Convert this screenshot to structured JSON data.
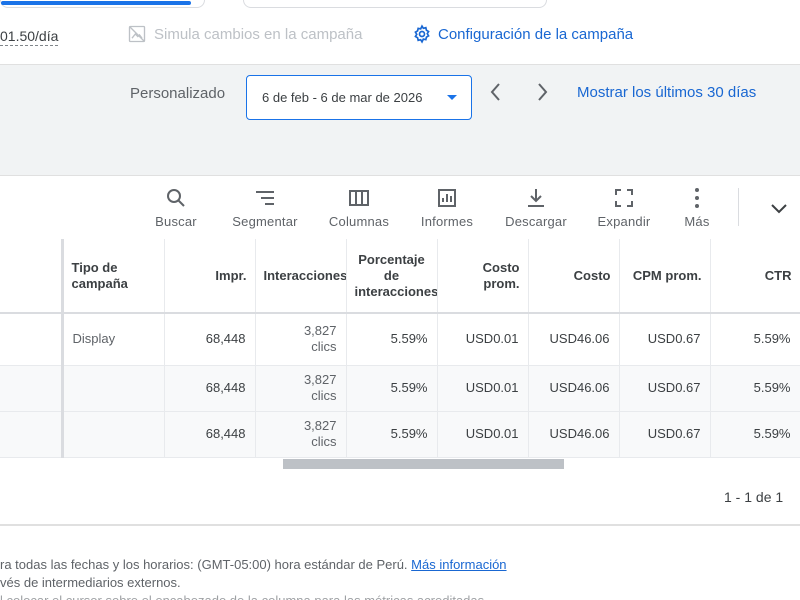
{
  "header": {
    "budget": "01.50/día",
    "simulate_label": "Simula cambios en la campaña",
    "config_label": "Configuración de la campaña"
  },
  "date_bar": {
    "preset_label": "Personalizado",
    "date_range": "6 de feb - 6 de mar de 2026",
    "show_last_label": "Mostrar los últimos 30 días"
  },
  "toolbar": {
    "items": [
      {
        "label": "Buscar",
        "icon": "search-icon"
      },
      {
        "label": "Segmentar",
        "icon": "segment-icon"
      },
      {
        "label": "Columnas",
        "icon": "columns-icon"
      },
      {
        "label": "Informes",
        "icon": "reports-icon"
      },
      {
        "label": "Descargar",
        "icon": "download-icon"
      },
      {
        "label": "Expandir",
        "icon": "expand-icon"
      },
      {
        "label": "Más",
        "icon": "more-vert-icon"
      }
    ]
  },
  "table": {
    "headers": [
      "Tipo de campaña",
      "Impr.",
      "Interacciones",
      "Porcentaje de interacciones",
      "Costo prom.",
      "Costo",
      "CPM prom.",
      "CTR"
    ],
    "rows": [
      {
        "type": "Display",
        "impr": "68,448",
        "inter_num": "3,827",
        "inter_unit": "clics",
        "rate": "5.59%",
        "avg_cost": "USD0.01",
        "cost": "USD46.06",
        "cpm": "USD0.67",
        "ctr": "5.59%"
      },
      {
        "type": "",
        "impr": "68,448",
        "inter_num": "3,827",
        "inter_unit": "clics",
        "rate": "5.59%",
        "avg_cost": "USD0.01",
        "cost": "USD46.06",
        "cpm": "USD0.67",
        "ctr": "5.59%"
      },
      {
        "type": "",
        "impr": "68,448",
        "inter_num": "3,827",
        "inter_unit": "clics",
        "rate": "5.59%",
        "avg_cost": "USD0.01",
        "cost": "USD46.06",
        "cpm": "USD0.67",
        "ctr": "5.59%"
      }
    ]
  },
  "pager": {
    "text": "1 - 1 de 1"
  },
  "footer": {
    "line1": "ra todas las fechas y los horarios: (GMT-05:00) hora estándar de Perú.",
    "line1_link": "Más información",
    "line2": "vés de intermediarios externos.",
    "line3": "l colocar el cursor sobre el encabezado de la columna para las métricas acreditadas"
  },
  "colors": {
    "accent": "#1a73e8",
    "link": "#1967d2",
    "band": "#f1f3f4"
  }
}
